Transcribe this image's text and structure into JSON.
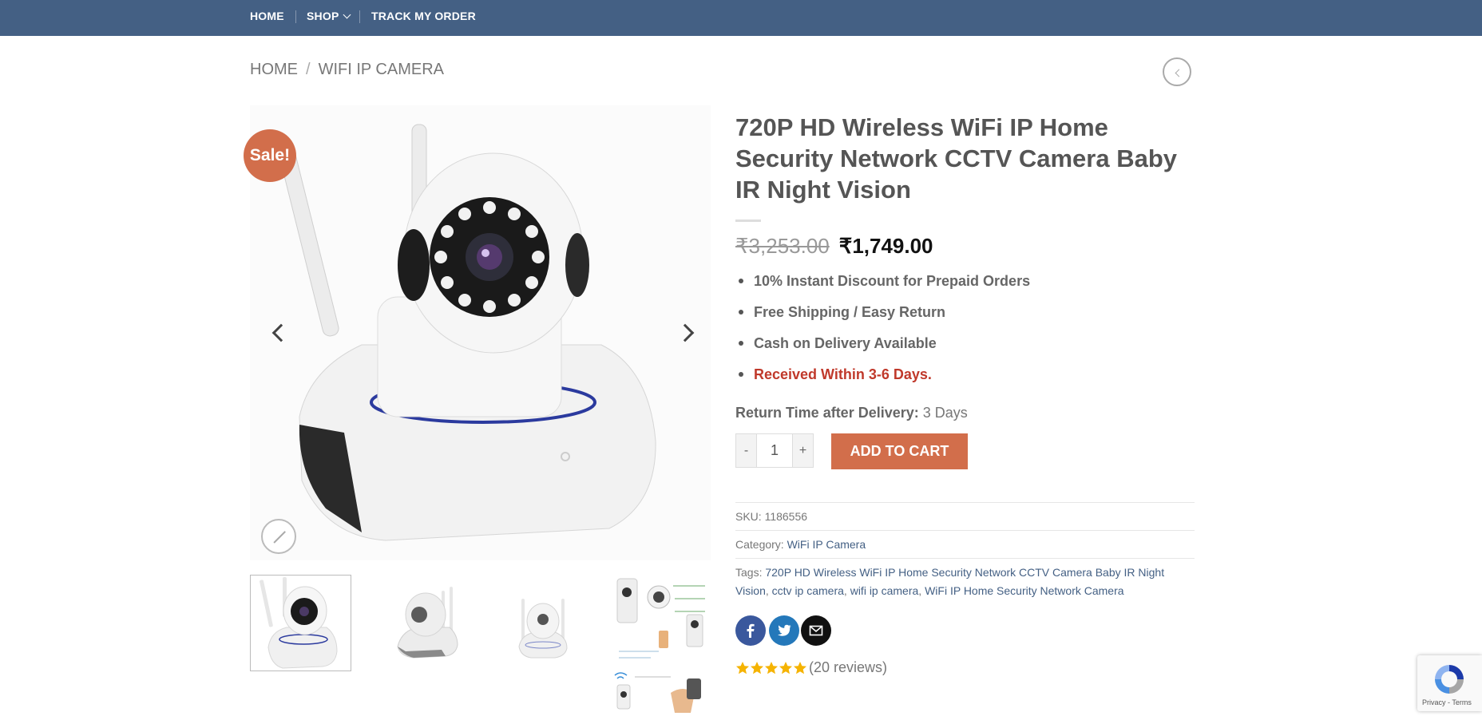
{
  "nav": {
    "items": [
      {
        "label": "HOME"
      },
      {
        "label": "SHOP"
      },
      {
        "label": "TRACK MY ORDER"
      }
    ]
  },
  "breadcrumb": {
    "home": "HOME",
    "separator": "/",
    "current": "WIFI IP CAMERA"
  },
  "gallery": {
    "sale_badge": "Sale!",
    "thumbnail_count": 5,
    "active_index": 0
  },
  "product": {
    "title": "720P HD Wireless WiFi IP Home Security Network CCTV Camera Baby IR Night Vision",
    "currency": "₹",
    "price_old": "3,253.00",
    "price_new": "1,749.00",
    "features": [
      "10% Instant Discount for Prepaid Orders",
      "Free Shipping / Easy Return",
      "Cash on Delivery Available",
      "Received Within 3-6 Days."
    ],
    "return_label": "Return Time after Delivery:",
    "return_value": "3 Days",
    "qty_minus": "-",
    "qty_value": "1",
    "qty_plus": "+",
    "add_to_cart": "ADD TO CART",
    "sku_label": "SKU:",
    "sku_value": "1186556",
    "category_label": "Category:",
    "category_value": "WiFi IP Camera",
    "tags_label": "Tags:",
    "tags": [
      "720P HD Wireless WiFi IP Home Security Network CCTV Camera Baby IR Night Vision",
      "cctv ip camera",
      "wifi ip camera",
      "WiFi IP Home Security Network Camera"
    ],
    "rating": 5,
    "reviews_text": "(20 reviews)"
  },
  "recaptcha": {
    "footer": "Privacy - Terms"
  },
  "colors": {
    "nav_bg": "#446084",
    "accent": "#d26e4b",
    "link": "#446084",
    "star": "#f5b301",
    "red_text": "#c0392b"
  }
}
